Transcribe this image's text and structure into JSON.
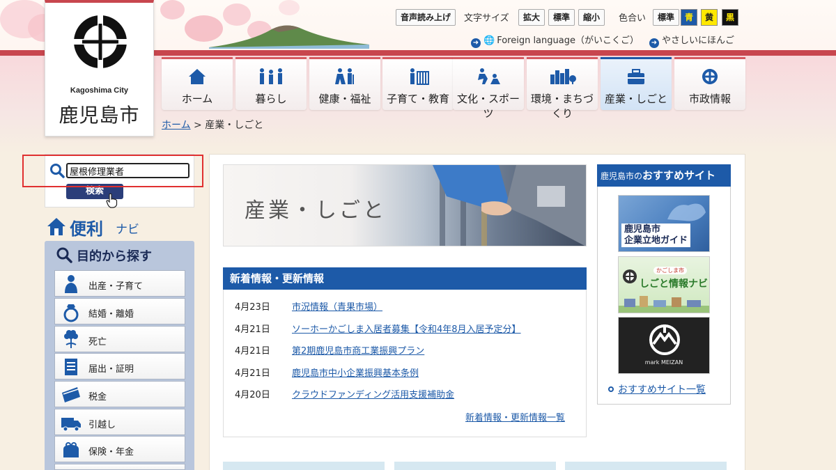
{
  "logo": {
    "en": "Kagoshima City",
    "jp": "鹿児島市"
  },
  "top_tools": {
    "read_aloud": "音声読み上げ",
    "font_size_label": "文字サイズ",
    "font_large": "拡大",
    "font_standard": "標準",
    "font_small": "縮小",
    "color_label": "色合い",
    "color_standard": "標準",
    "color_blue": "青",
    "color_yellow": "黄",
    "color_black": "黒",
    "foreign_language": "Foreign language（がいこくご）",
    "easy_japanese": "やさしいにほんご"
  },
  "nav": [
    {
      "label": "ホーム",
      "icon": "house-icon"
    },
    {
      "label": "暮らし",
      "icon": "family-icon"
    },
    {
      "label": "健康・福祉",
      "icon": "wellness-icon"
    },
    {
      "label": "子育て・教育",
      "icon": "child-icon"
    },
    {
      "label": "文化・スポーツ",
      "icon": "sports-icon"
    },
    {
      "label": "環境・まちづくり",
      "icon": "city-icon"
    },
    {
      "label": "産業・しごと",
      "icon": "briefcase-icon",
      "active": true
    },
    {
      "label": "市政情報",
      "icon": "city-emblem-icon"
    }
  ],
  "breadcrumb": {
    "home": "ホーム",
    "sep": ">",
    "current": "産業・しごと"
  },
  "search": {
    "value": "屋根修理業者",
    "button": "検索"
  },
  "benri": {
    "big": "便利",
    "small": "ナビ"
  },
  "purpose": {
    "title": "目的から探す",
    "items": [
      {
        "label": "出産・子育て",
        "icon": "mother-icon"
      },
      {
        "label": "結婚・離婚",
        "icon": "ring-icon"
      },
      {
        "label": "死亡",
        "icon": "flower-icon"
      },
      {
        "label": "届出・証明",
        "icon": "document-icon"
      },
      {
        "label": "税金",
        "icon": "envelope-icon"
      },
      {
        "label": "引越し",
        "icon": "truck-icon"
      },
      {
        "label": "保険・年金",
        "icon": "purse-icon"
      }
    ]
  },
  "hero": {
    "title": "産業・しごと"
  },
  "news": {
    "heading": "新着情報・更新情報",
    "items": [
      {
        "date": "4月23日",
        "title": "市況情報（青果市場）"
      },
      {
        "date": "4月21日",
        "title": "ソーホーかごしま入居者募集【令和4年8月入居予定分】"
      },
      {
        "date": "4月21日",
        "title": "第2期鹿児島市商工業振興プラン"
      },
      {
        "date": "4月21日",
        "title": "鹿児島市中小企業振興基本条例"
      },
      {
        "date": "4月20日",
        "title": "クラウドファンディング活用支援補助金"
      }
    ],
    "more": "新着情報・更新情報一覧"
  },
  "recommended": {
    "head_small": "鹿児島市の",
    "head_large": "おすすめサイト",
    "banner1": "鹿児島市\n企業立地ガイド",
    "banner2": "しごと情報ナビ",
    "banner2_sub": "かごしま市",
    "banner3": "mark MEIZAN",
    "more": "おすすめサイト一覧"
  },
  "colors": {
    "brand_red": "#c8464e",
    "brand_blue": "#1d5aa8",
    "panel_blue": "#b9c6dc",
    "highlight_red": "#e03030"
  }
}
